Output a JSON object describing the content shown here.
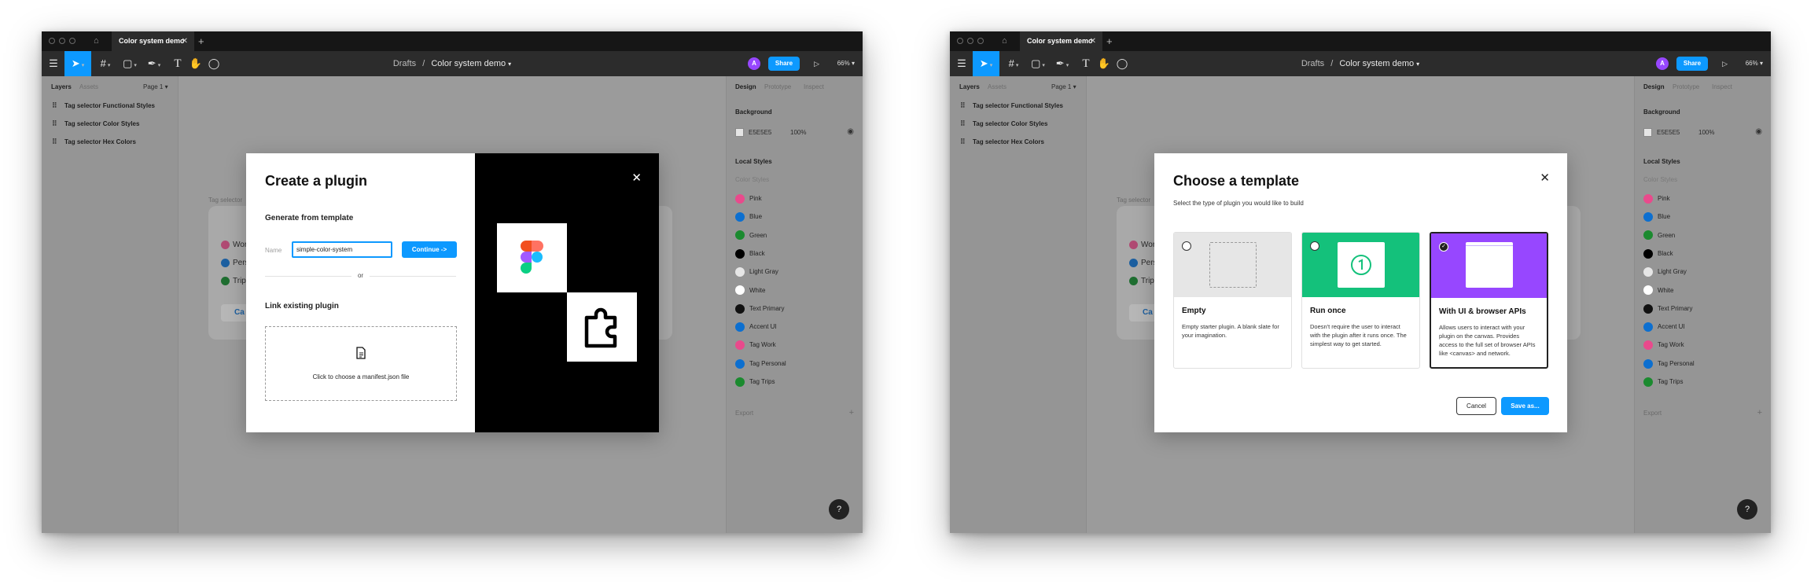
{
  "tab": {
    "title": "Color system demo",
    "close": "✕",
    "add": "+"
  },
  "toolbar": {
    "breadcrumb_parent": "Drafts",
    "breadcrumb_sep": "/",
    "file_name": "Color system demo",
    "avatar_initial": "A",
    "share_label": "Share",
    "zoom": "66%"
  },
  "left_panel": {
    "tab_layers": "Layers",
    "tab_assets": "Assets",
    "page": "Page 1",
    "layers": [
      "Tag selector Functional Styles",
      "Tag selector Color Styles",
      "Tag selector Hex Colors"
    ]
  },
  "right_panel": {
    "tab_design": "Design",
    "tab_prototype": "Prototype",
    "tab_inspect": "Inspect",
    "background_title": "Background",
    "background_hex": "E5E5E5",
    "background_opacity": "100%",
    "local_styles_title": "Local Styles",
    "color_styles_label": "Color Styles",
    "styles": [
      {
        "name": "Pink",
        "color": "#e94a8c"
      },
      {
        "name": "Blue",
        "color": "#0c6fd0"
      },
      {
        "name": "Green",
        "color": "#1b8a2f"
      },
      {
        "name": "Black",
        "color": "#000000"
      },
      {
        "name": "Light Gray",
        "color": "#e6e6e6"
      },
      {
        "name": "White",
        "color": "#ffffff"
      },
      {
        "name": "Text Primary",
        "color": "#111111"
      },
      {
        "name": "Accent UI",
        "color": "#0c6fd0"
      },
      {
        "name": "Tag Work",
        "color": "#e94a8c"
      },
      {
        "name": "Tag Personal",
        "color": "#0c6fd0"
      },
      {
        "name": "Tag Trips",
        "color": "#1b8a2f"
      }
    ],
    "export_label": "Export",
    "help": "?"
  },
  "canvas_bg": {
    "label": "Tag selector",
    "rows": [
      "Wor",
      "Pers",
      "Trip"
    ],
    "cancel_partial": "Ca"
  },
  "modal_create": {
    "title": "Create a plugin",
    "generate_heading": "Generate from template",
    "name_label": "Name",
    "name_value": "simple-color-system",
    "continue_label": "Continue ->",
    "or_label": "or",
    "link_heading": "Link existing plugin",
    "drop_text": "Click to choose a manifest.json file",
    "close": "✕"
  },
  "modal_template": {
    "title": "Choose a template",
    "subtitle": "Select the type of plugin you would like to build",
    "close": "✕",
    "cards": [
      {
        "title": "Empty",
        "desc": "Empty starter plugin. A blank slate for your imagination.",
        "color": "#e6e6e6",
        "selected": false
      },
      {
        "title": "Run once",
        "desc": "Doesn't require the user to interact with the plugin after it runs once. The simplest way to get started.",
        "color": "#14c17b",
        "selected": false
      },
      {
        "title": "With UI & browser APIs",
        "desc": "Allows users to interact with your plugin on the canvas. Provides access to the full set of browser APIs like <canvas> and network.",
        "color": "#9747ff",
        "selected": true
      }
    ],
    "cancel_label": "Cancel",
    "save_label": "Save as..."
  }
}
